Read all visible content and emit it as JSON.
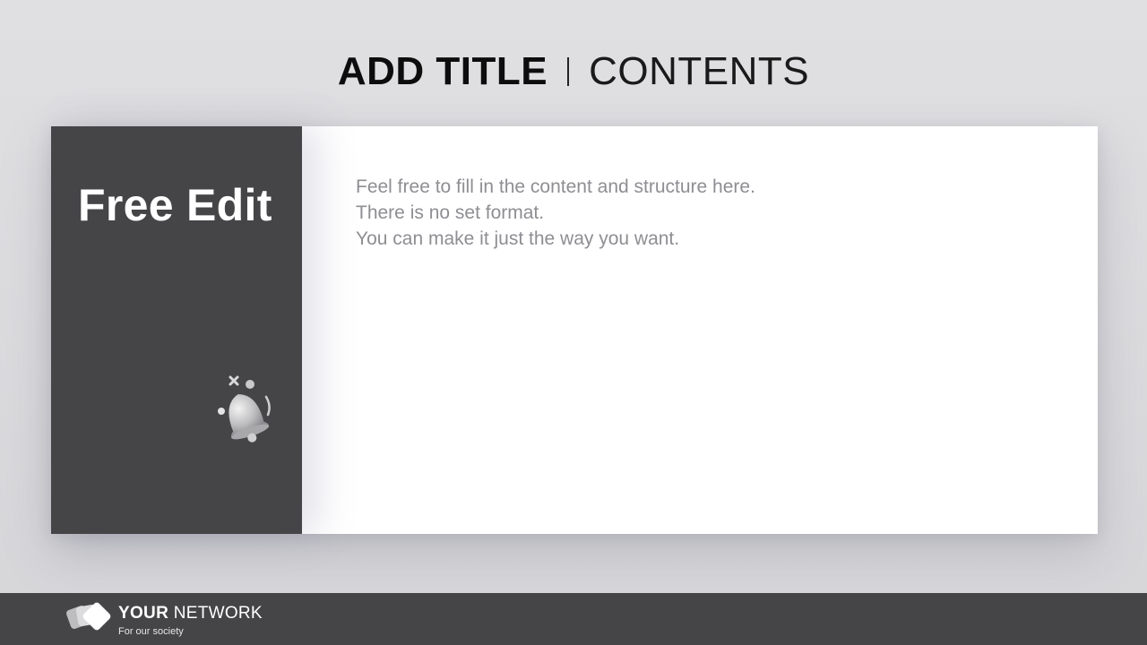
{
  "header": {
    "title_bold": "ADD TITLE",
    "title_light": "CONTENTS"
  },
  "card": {
    "side_title": "Free Edit",
    "icon": "bell-icon",
    "body_lines": [
      "Feel free to fill in the content and structure here.",
      "There is no set format.",
      "You can make it just the way you want."
    ]
  },
  "footer": {
    "brand_bold": "YOUR",
    "brand_light": "NETWORK",
    "tagline": "For our society",
    "logo_icon": "stacked-cards-logo"
  },
  "colors": {
    "background": "#dcdcde",
    "dark_panel": "#454548",
    "body_text": "#8e8e93",
    "card": "#ffffff"
  }
}
